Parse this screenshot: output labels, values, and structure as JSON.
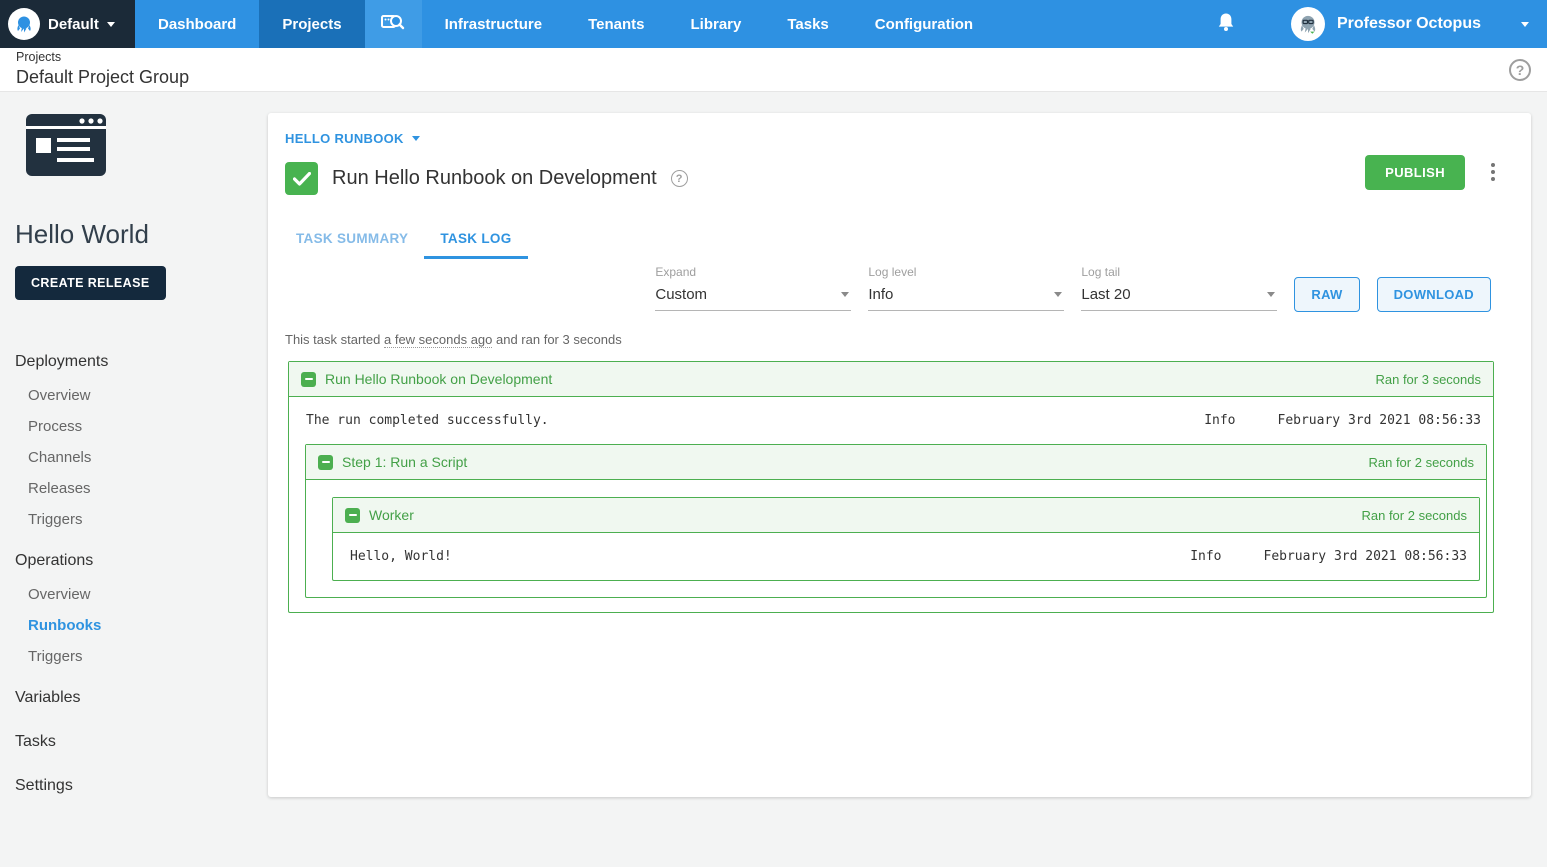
{
  "topnav": {
    "space_name": "Default",
    "items": [
      {
        "label": "Dashboard"
      },
      {
        "label": "Projects"
      },
      {
        "label": "Infrastructure"
      },
      {
        "label": "Tenants"
      },
      {
        "label": "Library"
      },
      {
        "label": "Tasks"
      },
      {
        "label": "Configuration"
      }
    ],
    "user_name": "Professor Octopus"
  },
  "breadcrumb": {
    "parent": "Projects",
    "title": "Default Project Group",
    "help_glyph": "?"
  },
  "sidebar": {
    "project_name": "Hello World",
    "create_release_label": "CREATE RELEASE",
    "nav": [
      {
        "label": "Deployments"
      },
      {
        "label": "Overview"
      },
      {
        "label": "Process"
      },
      {
        "label": "Channels"
      },
      {
        "label": "Releases"
      },
      {
        "label": "Triggers"
      },
      {
        "label": "Operations"
      },
      {
        "label": "Overview"
      },
      {
        "label": "Runbooks"
      },
      {
        "label": "Triggers"
      },
      {
        "label": "Variables"
      },
      {
        "label": "Tasks"
      },
      {
        "label": "Settings"
      }
    ]
  },
  "main": {
    "runbook_link": "HELLO RUNBOOK",
    "title": "Run Hello Runbook on Development",
    "title_help_glyph": "?",
    "publish_label": "PUBLISH",
    "tabs": [
      {
        "label": "TASK SUMMARY"
      },
      {
        "label": "TASK LOG"
      }
    ],
    "filters": {
      "expand": {
        "label": "Expand",
        "value": "Custom"
      },
      "log_level": {
        "label": "Log level",
        "value": "Info"
      },
      "log_tail": {
        "label": "Log tail",
        "value": "Last 20"
      }
    },
    "raw_label": "RAW",
    "download_label": "DOWNLOAD",
    "summary": {
      "prefix": "This task started ",
      "time": "a few seconds ago",
      "suffix": " and ran for 3 seconds"
    },
    "log": {
      "root": {
        "title": "Run Hello Runbook on Development",
        "duration": "Ran for 3 seconds"
      },
      "root_row": {
        "message": "The run completed successfully.",
        "level": "Info",
        "timestamp": "February 3rd 2021 08:56:33"
      },
      "step": {
        "title": "Step 1: Run a Script",
        "duration": "Ran for 2 seconds"
      },
      "worker": {
        "title": "Worker",
        "duration": "Ran for 2 seconds"
      },
      "worker_row": {
        "message": "Hello, World!",
        "level": "Info",
        "timestamp": "February 3rd 2021 08:56:33"
      }
    }
  },
  "colors": {
    "nav_blue": "#2e91e2",
    "nav_active_blue": "#1a70b8",
    "dark_navy": "#1b2a38",
    "green": "#48b350",
    "log_green_border": "#4caf50",
    "log_green_bg": "#f0f8f0",
    "link_blue": "#2f93e0"
  }
}
